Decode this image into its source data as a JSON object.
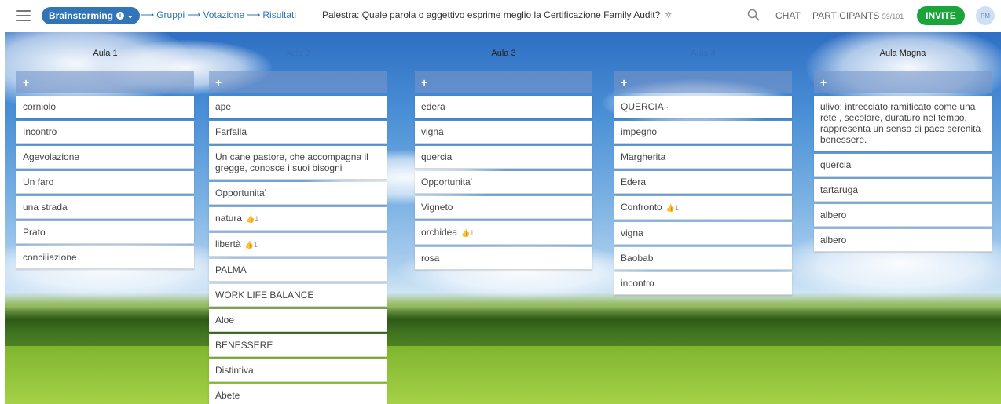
{
  "header": {
    "phase_label": "Brainstorming",
    "steps": [
      "Gruppi",
      "Votazione",
      "Risultati"
    ],
    "session_title": "Palestra: Quale parola o aggettivo esprime meglio la Certificazione Family Audit?",
    "chat_label": "CHAT",
    "participants_label": "PARTICIPANTS",
    "participants_count": "59/101",
    "invite_label": "INVITE",
    "avatar_initials": "PM"
  },
  "columns": [
    {
      "title": "Aula 1",
      "faded": false,
      "add_symbol": "+",
      "cards": [
        {
          "text": "corniolo"
        },
        {
          "text": "Incontro"
        },
        {
          "text": "Agevolazione"
        },
        {
          "text": "Un faro"
        },
        {
          "text": "una strada"
        },
        {
          "text": "Prato"
        },
        {
          "text": "conciliazione"
        }
      ]
    },
    {
      "title": "Aula 2",
      "faded": true,
      "add_symbol": "+",
      "cards": [
        {
          "text": "ape"
        },
        {
          "text": "Farfalla"
        },
        {
          "text": "Un cane pastore, che accompagna il gregge, conosce i suoi bisogni"
        },
        {
          "text": "Opportunita'"
        },
        {
          "text": "natura",
          "likes": "1"
        },
        {
          "text": "libertà",
          "likes": "1"
        },
        {
          "text": "PALMA"
        },
        {
          "text": "WORK LIFE BALANCE"
        },
        {
          "text": "Aloe"
        },
        {
          "text": "BENESSERE"
        },
        {
          "text": "Distintiva"
        },
        {
          "text": "Abete"
        }
      ]
    },
    {
      "title": "Aula 3",
      "faded": false,
      "add_symbol": "+",
      "cards": [
        {
          "text": "edera"
        },
        {
          "text": "vigna"
        },
        {
          "text": "quercia"
        },
        {
          "text": "Opportunita'"
        },
        {
          "text": "Vigneto"
        },
        {
          "text": "orchidea",
          "likes": "1"
        },
        {
          "text": "rosa"
        }
      ]
    },
    {
      "title": "Aula 4",
      "faded": true,
      "add_symbol": "+",
      "cards": [
        {
          "text": "QUERCIA ·"
        },
        {
          "text": "impegno"
        },
        {
          "text": "Margherita"
        },
        {
          "text": "Edera"
        },
        {
          "text": "Confronto",
          "likes": "1"
        },
        {
          "text": "vigna"
        },
        {
          "text": "Baobab"
        },
        {
          "text": "incontro"
        }
      ]
    },
    {
      "title": "Aula Magna",
      "faded": false,
      "add_symbol": "+",
      "cards": [
        {
          "text": "ulivo: intrecciato ramificato come una rete , secolare, duraturo nel tempo, rappresenta un senso di pace serenità benessere."
        },
        {
          "text": "quercia"
        },
        {
          "text": "tartaruga"
        },
        {
          "text": "albero"
        },
        {
          "text": "albero"
        }
      ]
    }
  ],
  "icons": {
    "menu": "hamburger-icon",
    "info": "info-icon",
    "chevron": "chevron-down-icon",
    "gear": "gear-icon",
    "search": "search-icon",
    "add": "plus-icon",
    "like": "thumbs-up-icon"
  },
  "colors": {
    "accent": "#3174b8",
    "invite": "#1aa43a",
    "add_bar": "#7896c8"
  }
}
